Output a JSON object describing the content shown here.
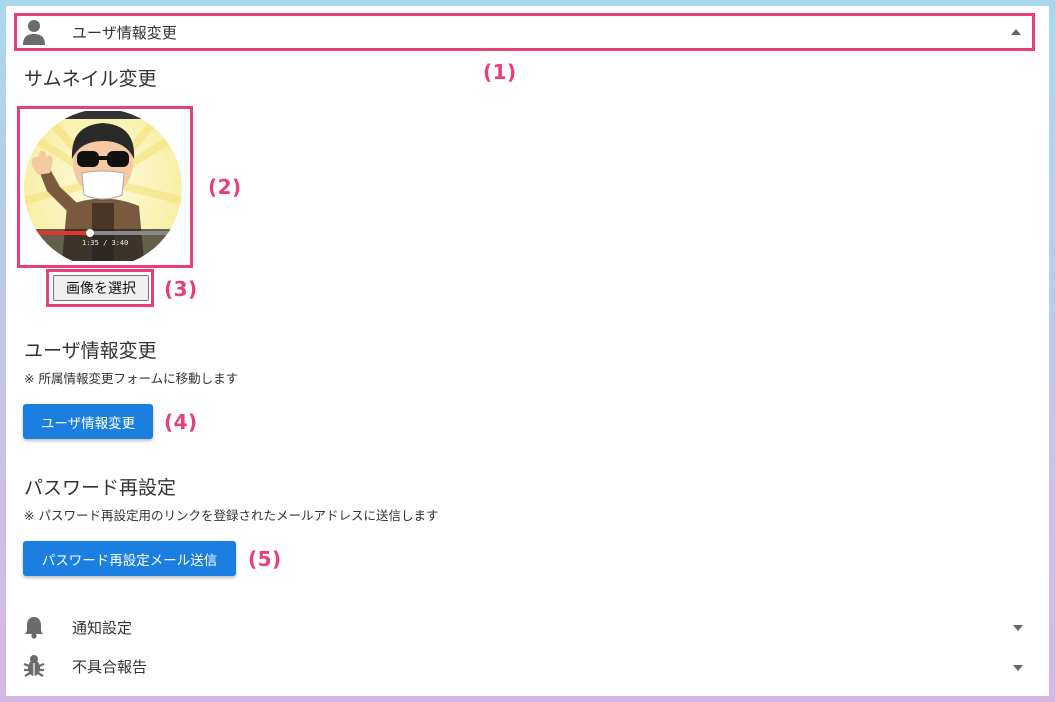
{
  "colors": {
    "accent": "#1a7fe0",
    "highlight": "#e83e7b"
  },
  "header": {
    "title": "ユーザ情報変更",
    "icon": "person-icon",
    "expanded": true
  },
  "thumbnail": {
    "heading": "サムネイル変更",
    "video_time": "1:35 / 3:40",
    "select_label": "画像を選択"
  },
  "user_info": {
    "heading": "ユーザ情報変更",
    "note": "※ 所属情報変更フォームに移動します",
    "button_label": "ユーザ情報変更"
  },
  "password": {
    "heading": "パスワード再設定",
    "note": "※ パスワード再設定用のリンクを登録されたメールアドレスに送信します",
    "button_label": "パスワード再設定メール送信"
  },
  "sections": [
    {
      "label": "通知設定",
      "icon": "bell-icon"
    },
    {
      "label": "不具合報告",
      "icon": "bug-icon"
    }
  ],
  "callouts": [
    "(1)",
    "(2)",
    "(3)",
    "(4)",
    "(5)"
  ]
}
